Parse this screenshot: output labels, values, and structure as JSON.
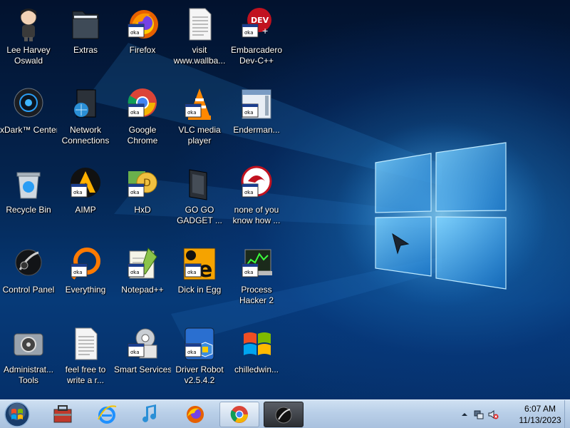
{
  "desktop": {
    "icons": [
      {
        "label": "Lee Harvey\nOswald",
        "icon": "cartoon-person-icon"
      },
      {
        "label": "Extras",
        "icon": "folder-icon"
      },
      {
        "label": "Firefox",
        "icon": "firefox-icon"
      },
      {
        "label": "visit\nwww.wallba...",
        "icon": "text-document-icon"
      },
      {
        "label": "Embarcadero\nDev-C++",
        "icon": "dev-cpp-icon"
      },
      {
        "label": "xDark™ Center",
        "icon": "xdark-center-icon"
      },
      {
        "label": "Network\nConnections",
        "icon": "network-connections-icon"
      },
      {
        "label": "Google\nChrome",
        "icon": "chrome-icon"
      },
      {
        "label": "VLC media\nplayer",
        "icon": "vlc-icon"
      },
      {
        "label": "Enderman...",
        "icon": "window-app-icon"
      },
      {
        "label": "Recycle Bin",
        "icon": "recycle-bin-icon"
      },
      {
        "label": "AIMP",
        "icon": "aimp-icon"
      },
      {
        "label": "HxD",
        "icon": "hxd-icon"
      },
      {
        "label": "GO GO\nGADGET ...",
        "icon": "folder-dark-icon"
      },
      {
        "label": "none of you\nknow how ...",
        "icon": "red-swirl-icon"
      },
      {
        "label": "Control Panel",
        "icon": "control-panel-icon"
      },
      {
        "label": "Everything",
        "icon": "everything-search-icon"
      },
      {
        "label": "Notepad++",
        "icon": "notepad-plus-plus-icon"
      },
      {
        "label": "Dick in Egg",
        "icon": "dick-in-egg-icon"
      },
      {
        "label": "Process\nHacker 2",
        "icon": "process-hacker-icon"
      },
      {
        "label": "Administrat...\nTools",
        "icon": "admin-tools-icon"
      },
      {
        "label": "feel free to\nwrite a r...",
        "icon": "text-document-icon"
      },
      {
        "label": "Smart Services",
        "icon": "smart-services-icon"
      },
      {
        "label": "Driver Robot\nv2.5.4.2",
        "icon": "driver-robot-icon"
      },
      {
        "label": "chilledwin...",
        "icon": "windows-flag-icon"
      }
    ]
  },
  "taskbar": {
    "pinned": [
      {
        "name": "toolbox-icon"
      },
      {
        "name": "internet-explorer-icon"
      },
      {
        "name": "itunes-icon"
      },
      {
        "name": "firefox-icon"
      },
      {
        "name": "chrome-icon"
      },
      {
        "name": "control-panel-icon"
      }
    ],
    "clock": {
      "time": "6:07 AM",
      "date": "11/13/2023"
    }
  },
  "colors": {
    "taskbar": "#b9cfe8",
    "wallpaper": "#04244f",
    "accent": "#2d8cff"
  }
}
